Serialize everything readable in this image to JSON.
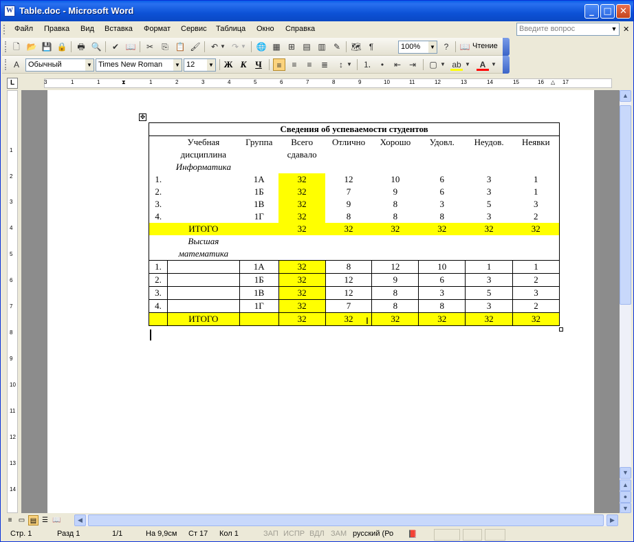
{
  "title": "Table.doc - Microsoft Word",
  "menu": [
    "Файл",
    "Правка",
    "Вид",
    "Вставка",
    "Формат",
    "Сервис",
    "Таблица",
    "Окно",
    "Справка"
  ],
  "ask_placeholder": "Введите вопрос",
  "toolbar": {
    "zoom": "100%",
    "reading_label": "Чтение"
  },
  "format": {
    "style": "Обычный",
    "font": "Times New Roman",
    "size": "12",
    "bold": "Ж",
    "italic": "К",
    "underline": "Ч"
  },
  "ruler_h": [
    "3",
    "1",
    "2",
    "1",
    "1",
    "2",
    "3",
    "4",
    "5",
    "6",
    "7",
    "8",
    "9",
    "10",
    "11",
    "12",
    "13",
    "14",
    "15",
    "16",
    "17"
  ],
  "ruler_v": [
    "1",
    "1",
    "2",
    "3",
    "4",
    "5",
    "6",
    "7",
    "8",
    "9",
    "10",
    "11",
    "12",
    "13",
    "14"
  ],
  "table": {
    "title": "Сведения об успеваемости студентов",
    "headers": {
      "discipline": [
        "Учебная",
        "дисциплина"
      ],
      "group": "Группа",
      "total": [
        "Всего",
        "сдавало"
      ],
      "excellent": "Отлично",
      "good": "Хорошо",
      "satisfactory": "Удовл.",
      "unsatisfactory": "Неудов.",
      "absent": "Неявки"
    },
    "sections": [
      {
        "name": "Информатика",
        "rows": [
          {
            "num": "1.",
            "group": "1А",
            "total": "32",
            "excellent": "12",
            "good": "10",
            "satisfactory": "6",
            "unsatisfactory": "3",
            "absent": "1"
          },
          {
            "num": "2.",
            "group": "1Б",
            "total": "32",
            "excellent": "7",
            "good": "9",
            "satisfactory": "6",
            "unsatisfactory": "3",
            "absent": "1"
          },
          {
            "num": "3.",
            "group": "1В",
            "total": "32",
            "excellent": "9",
            "good": "8",
            "satisfactory": "3",
            "unsatisfactory": "5",
            "absent": "3"
          },
          {
            "num": "4.",
            "group": "1Г",
            "total": "32",
            "excellent": "8",
            "good": "8",
            "satisfactory": "8",
            "unsatisfactory": "3",
            "absent": "2"
          }
        ],
        "total_row": {
          "label": "ИТОГО",
          "values": [
            "32",
            "32",
            "32",
            "32",
            "32",
            "32"
          ]
        }
      },
      {
        "name": [
          "Высшая",
          "математика"
        ],
        "rows": [
          {
            "num": "1.",
            "group": "1А",
            "total": "32",
            "excellent": "8",
            "good": "12",
            "satisfactory": "10",
            "unsatisfactory": "1",
            "absent": "1"
          },
          {
            "num": "2.",
            "group": "1Б",
            "total": "32",
            "excellent": "12",
            "good": "9",
            "satisfactory": "6",
            "unsatisfactory": "3",
            "absent": "2"
          },
          {
            "num": "3.",
            "group": "1В",
            "total": "32",
            "excellent": "12",
            "good": "8",
            "satisfactory": "3",
            "unsatisfactory": "5",
            "absent": "3"
          },
          {
            "num": "4.",
            "group": "1Г",
            "total": "32",
            "excellent": "7",
            "good": "8",
            "satisfactory": "8",
            "unsatisfactory": "3",
            "absent": "2"
          }
        ],
        "total_row": {
          "label": "ИТОГО",
          "values": [
            "32",
            "32",
            "32",
            "32",
            "32",
            "32"
          ]
        }
      }
    ]
  },
  "status": {
    "page": "Стр. 1",
    "section": "Разд 1",
    "pages": "1/1",
    "at": "На 9,9см",
    "line": "Ст 17",
    "col": "Кол 1",
    "rec": "ЗАП",
    "trk": "ИСПР",
    "ext": "ВДЛ",
    "ovr": "ЗАМ",
    "lang": "русский (Ро"
  },
  "colors": {
    "highlight": "#FFFF00",
    "titlebar": "#0A5FE8"
  }
}
